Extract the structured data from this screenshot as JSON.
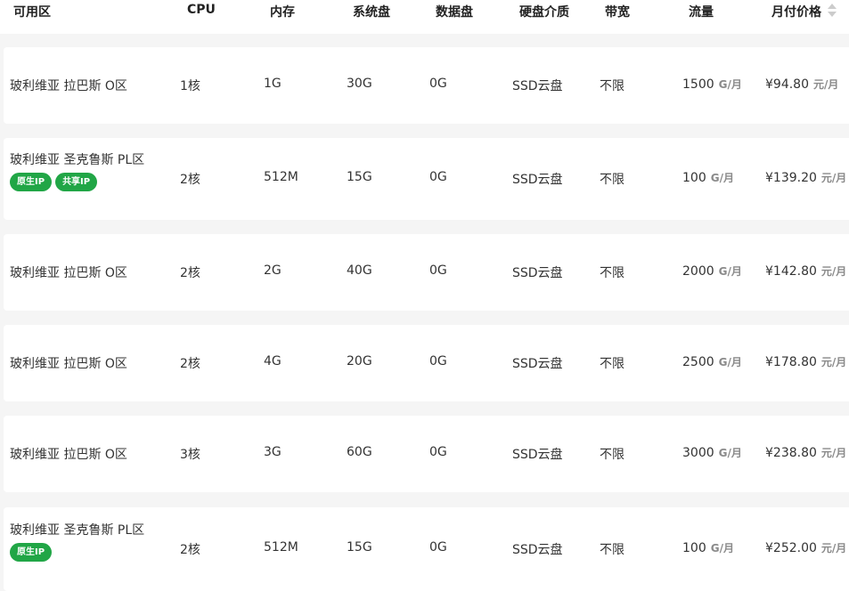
{
  "header": {
    "zone": "可用区",
    "cpu": "CPU",
    "memory": "内存",
    "system_disk": "系统盘",
    "data_disk": "数据盘",
    "disk_media": "硬盘介质",
    "bandwidth": "带宽",
    "traffic": "流量",
    "monthly_price": "月付价格"
  },
  "colors": {
    "tag_green": "#21a646",
    "page_bg": "#f5f5f5",
    "row_bg": "#ffffff",
    "unit_gray": "#8a8a8a"
  },
  "rows": [
    {
      "zone": "玻利维亚 拉巴斯 O区",
      "tags": [],
      "cpu": "1核",
      "memory": "1G",
      "system_disk": "30G",
      "data_disk": "0G",
      "disk_media": "SSD云盘",
      "bandwidth": "不限",
      "traffic": "1500",
      "traffic_unit": "G/月",
      "price": "¥94.80",
      "price_unit": "元/月"
    },
    {
      "zone": "玻利维亚 圣克鲁斯 PL区",
      "tags": [
        "原生IP",
        "共享IP"
      ],
      "cpu": "2核",
      "memory": "512M",
      "system_disk": "15G",
      "data_disk": "0G",
      "disk_media": "SSD云盘",
      "bandwidth": "不限",
      "traffic": "100",
      "traffic_unit": "G/月",
      "price": "¥139.20",
      "price_unit": "元/月"
    },
    {
      "zone": "玻利维亚 拉巴斯 O区",
      "tags": [],
      "cpu": "2核",
      "memory": "2G",
      "system_disk": "40G",
      "data_disk": "0G",
      "disk_media": "SSD云盘",
      "bandwidth": "不限",
      "traffic": "2000",
      "traffic_unit": "G/月",
      "price": "¥142.80",
      "price_unit": "元/月"
    },
    {
      "zone": "玻利维亚 拉巴斯 O区",
      "tags": [],
      "cpu": "2核",
      "memory": "4G",
      "system_disk": "20G",
      "data_disk": "0G",
      "disk_media": "SSD云盘",
      "bandwidth": "不限",
      "traffic": "2500",
      "traffic_unit": "G/月",
      "price": "¥178.80",
      "price_unit": "元/月"
    },
    {
      "zone": "玻利维亚 拉巴斯 O区",
      "tags": [],
      "cpu": "3核",
      "memory": "3G",
      "system_disk": "60G",
      "data_disk": "0G",
      "disk_media": "SSD云盘",
      "bandwidth": "不限",
      "traffic": "3000",
      "traffic_unit": "G/月",
      "price": "¥238.80",
      "price_unit": "元/月"
    },
    {
      "zone": "玻利维亚 圣克鲁斯 PL区",
      "tags": [
        "原生IP"
      ],
      "cpu": "2核",
      "memory": "512M",
      "system_disk": "15G",
      "data_disk": "0G",
      "disk_media": "SSD云盘",
      "bandwidth": "不限",
      "traffic": "100",
      "traffic_unit": "G/月",
      "price": "¥252.00",
      "price_unit": "元/月"
    }
  ]
}
